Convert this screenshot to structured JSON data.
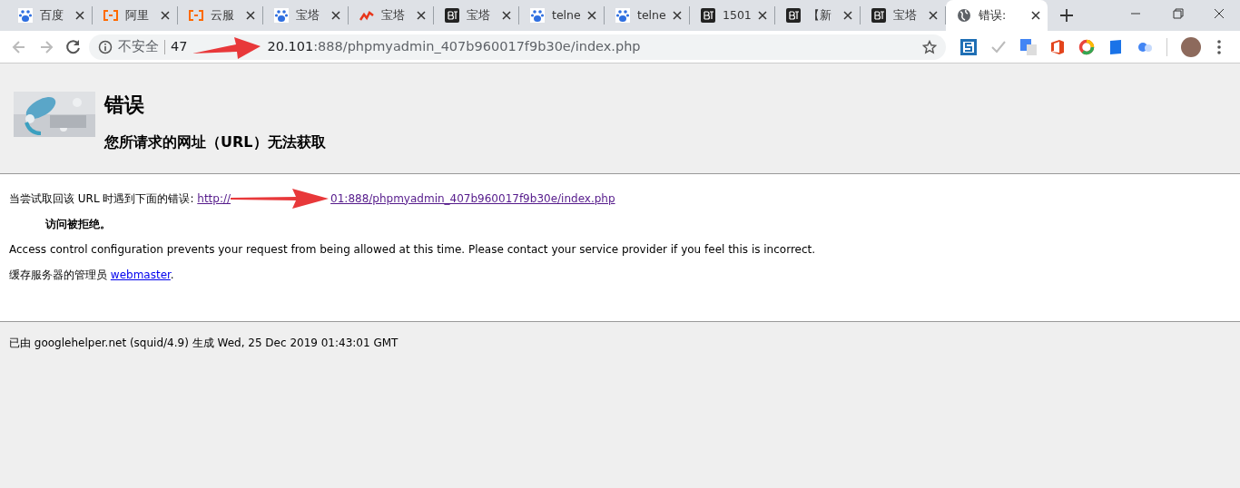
{
  "tabs": [
    {
      "kind": "paw",
      "label": "百度",
      "selected": false
    },
    {
      "kind": "bracket",
      "label": "阿里",
      "selected": false
    },
    {
      "kind": "bracket",
      "label": "云服",
      "selected": false
    },
    {
      "kind": "paw",
      "label": "宝塔",
      "selected": false
    },
    {
      "kind": "wave",
      "label": "宝塔",
      "selected": false
    },
    {
      "kind": "bt",
      "label": "宝塔",
      "selected": false
    },
    {
      "kind": "paw",
      "label": "telne",
      "selected": false
    },
    {
      "kind": "paw",
      "label": "telne",
      "selected": false
    },
    {
      "kind": "bt",
      "label": "1501",
      "selected": false
    },
    {
      "kind": "bt",
      "label": "【新",
      "selected": false
    },
    {
      "kind": "bt",
      "label": "宝塔",
      "selected": false
    },
    {
      "kind": "globe",
      "label": "错误:",
      "selected": true
    }
  ],
  "address_bar": {
    "security": "不安全",
    "host_start": "47",
    "host_end": "20.101",
    "path": ":888/phpmyadmin_407b960017f9b30e/index.php"
  },
  "page": {
    "heading": "错误",
    "subheading": "您所请求的网址（URL）无法获取",
    "intro": "当尝试取回该 URL 时遇到下面的错误:",
    "link_start": "http://",
    "link_end": "01:888/phpmyadmin_407b960017f9b30e/index.php",
    "error": "访问被拒绝。",
    "description": "Access control configuration prevents your request from being allowed at this time. Please contact your service provider if you feel this is incorrect.",
    "admin_text": "缓存服务器的管理员",
    "admin_link": "webmaster",
    "admin_end": ".",
    "footer": "已由 googlehelper.net (squid/4.9) 生成 Wed, 25 Dec 2019 01:43:01 GMT"
  }
}
